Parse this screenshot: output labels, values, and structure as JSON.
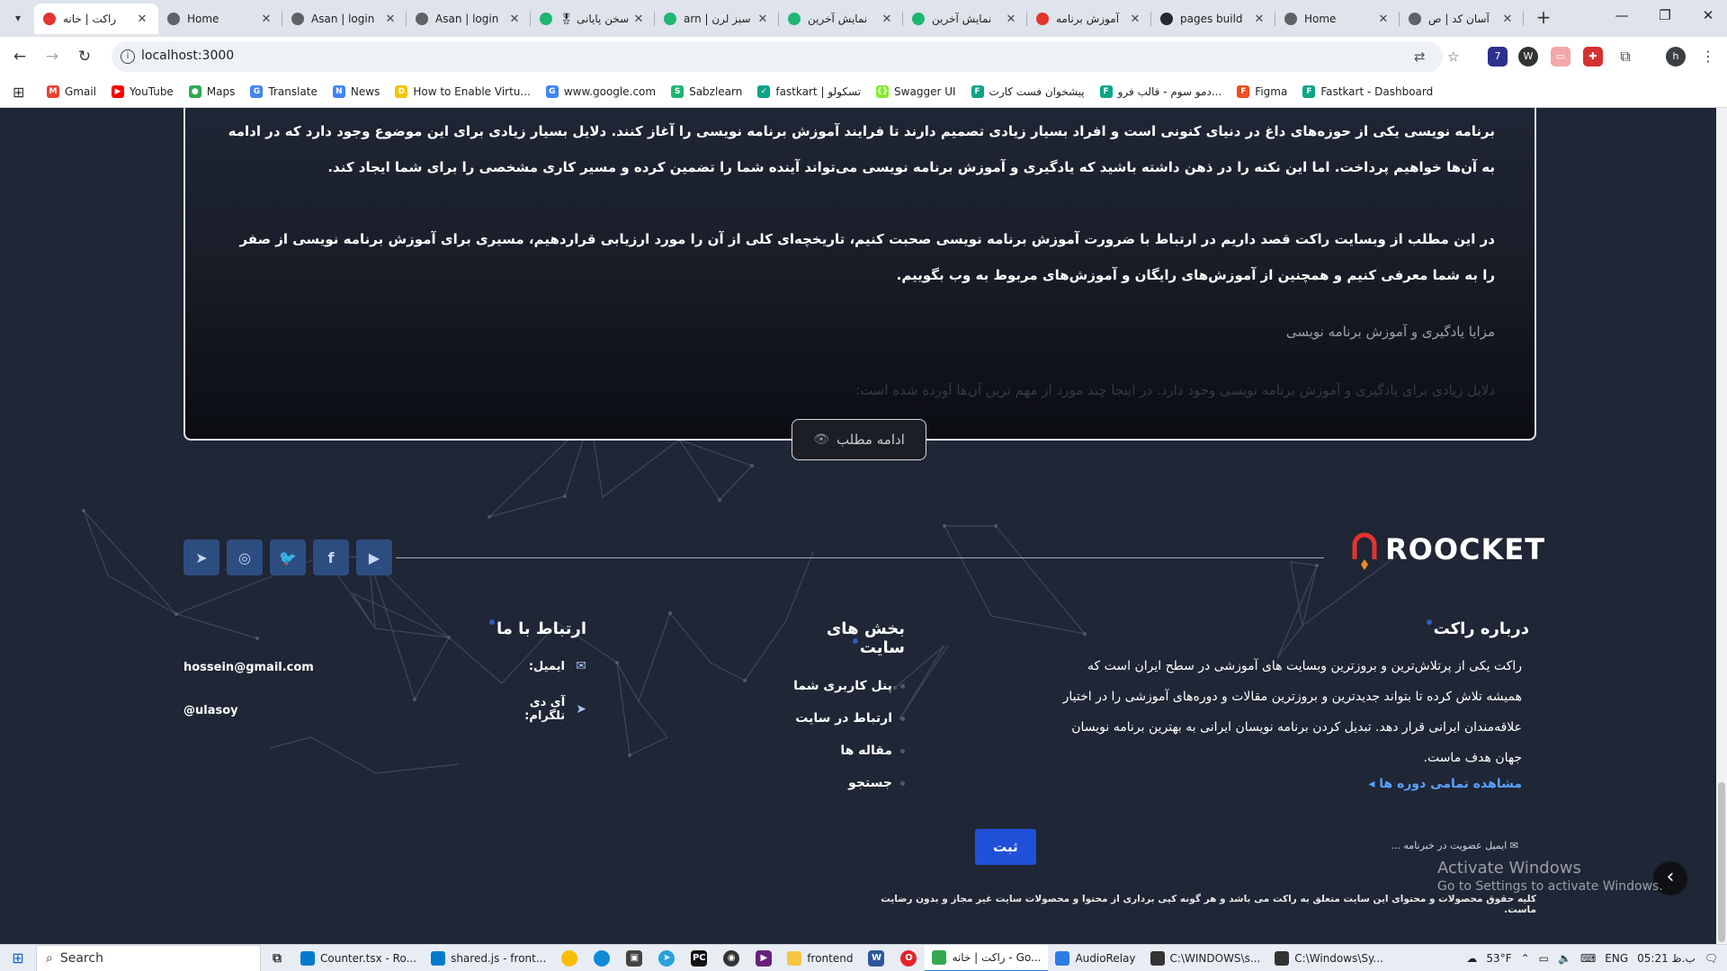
{
  "browser": {
    "tabs": [
      {
        "label": "راکت | خانه",
        "favicon": "roocket-icon",
        "color": "#e3342f",
        "active": true
      },
      {
        "label": "Home",
        "favicon": "globe-icon",
        "color": "#5f6368"
      },
      {
        "label": "Asan | login",
        "favicon": "globe-icon",
        "color": "#5f6368"
      },
      {
        "label": "Asan | login",
        "favicon": "globe-icon",
        "color": "#5f6368"
      },
      {
        "label": "سخن پایانی 🎖",
        "favicon": "sabzlearn-icon",
        "color": "#1fb573"
      },
      {
        "label": "سبز لرن | arn",
        "favicon": "sabzlearn-icon",
        "color": "#1fb573"
      },
      {
        "label": "نمایش آخرین",
        "favicon": "sabzlearn-icon",
        "color": "#1fb573"
      },
      {
        "label": "نمایش آخرین",
        "favicon": "sabzlearn-icon",
        "color": "#1fb573"
      },
      {
        "label": "آموزش برنامه",
        "favicon": "roocket-icon",
        "color": "#e3342f"
      },
      {
        "label": "pages build",
        "favicon": "github-icon",
        "color": "#24292f"
      },
      {
        "label": "Home",
        "favicon": "globe-icon",
        "color": "#5f6368"
      },
      {
        "label": "آسان کد | ص",
        "favicon": "globe-icon",
        "color": "#5f6368"
      }
    ],
    "new_tab_symbol": "+",
    "url": "localhost:3000",
    "bookmarks": [
      {
        "label": "Gmail",
        "icon": "gmail-icon",
        "color": "#ea4335",
        "glyph": "M"
      },
      {
        "label": "YouTube",
        "icon": "youtube-icon",
        "color": "#ff0000",
        "glyph": "▶"
      },
      {
        "label": "Maps",
        "icon": "maps-icon",
        "color": "#34a853",
        "glyph": "●"
      },
      {
        "label": "Translate",
        "icon": "translate-icon",
        "color": "#4285f4",
        "glyph": "G"
      },
      {
        "label": "News",
        "icon": "news-icon",
        "color": "#4285f4",
        "glyph": "N"
      },
      {
        "label": "How to Enable Virtu...",
        "icon": "bookmark-site-icon",
        "color": "#f5c400",
        "glyph": "D"
      },
      {
        "label": "www.google.com",
        "icon": "google-icon",
        "color": "#4285f4",
        "glyph": "G"
      },
      {
        "label": "Sabzlearn",
        "icon": "sabzlearn-icon",
        "color": "#1fb573",
        "glyph": "S"
      },
      {
        "label": "fastkart | تسکولو",
        "icon": "fastkart-icon",
        "color": "#0da487",
        "glyph": "✓"
      },
      {
        "label": "Swagger UI",
        "icon": "swagger-icon",
        "color": "#85ea2d",
        "glyph": "{}"
      },
      {
        "label": "پیشخوان فست کارت",
        "icon": "fastkart-icon",
        "color": "#0da487",
        "glyph": "F"
      },
      {
        "label": "دمو سوم - قالب فرو...",
        "icon": "fastkart-icon",
        "color": "#0da487",
        "glyph": "F"
      },
      {
        "label": "Figma",
        "icon": "figma-icon",
        "color": "#f24e1e",
        "glyph": "F"
      },
      {
        "label": "Fastkart - Dashboard",
        "icon": "fastkart-icon",
        "color": "#0da487",
        "glyph": "F"
      }
    ]
  },
  "article": {
    "paragraph1": "برنامه نویسی یکی از حوزه‌های داغ در دنیای کنونی است و افراد بسیار زیادی تصمیم دارند تا فرایند آموزش برنامه نویسی را آغاز کنند. دلایل بسیار زیادی برای این موضوع وجود دارد که در ادامه به آن‌ها خواهیم پرداخت. اما این نکته را در ذهن داشته باشید که یادگیری و آموزش برنامه نویسی می‌تواند آینده شما را تضمین کرده و مسیر کاری مشخصی را برای شما ایجاد کند.",
    "paragraph2": "در این مطلب از وبسایت راکت قصد داریم در ارتباط با ضرورت آموزش برنامه نویسی صحبت کنیم، تاریخچه‌ای کلی از آن را مورد ارزیابی قراردهیم، مسیری برای آموزش برنامه نویسی از صفر را به شما معرفی کنیم و همچنین از آموزش‌های رایگان و آموزش‌های مربوط به وب بگوییم.",
    "heading": "مزایا یادگیری و آموزش برنامه نویسی",
    "paragraph3": "دلایل زیادی برای یادگیری و آموزش برنامه نویسی وجود دارد. در اینجا چند مورد از مهم ترین آن‌ها آورده شده است:",
    "read_more": "ادامه مطلب"
  },
  "footer": {
    "logo_text": "ROOCKET",
    "socials": [
      {
        "name": "telegram-icon",
        "glyph": "➤"
      },
      {
        "name": "instagram-icon",
        "glyph": "◎"
      },
      {
        "name": "twitter-icon",
        "glyph": "🐦"
      },
      {
        "name": "facebook-icon",
        "glyph": "f"
      },
      {
        "name": "youtube-icon",
        "glyph": "▶"
      }
    ],
    "about": {
      "title": "درباره راکت",
      "text": "راکت یکی از پرتلاش‌ترین و بروزترین وبسایت های آموزشی در سطح ایران است که همیشه تلاش کرده تا بتواند جدیدترین و بروزترین مقالات و دوره‌های آموزشی را در اختیار علاقه‌مندان ایرانی قرار دهد. تبدیل کردن برنامه نویسان ایرانی به بهترین برنامه نویسان جهان هدف ماست.",
      "link": "مشاهده تمامی دوره ها ◂"
    },
    "sections": {
      "title": "بخش های سایت",
      "items": [
        "پنل کاربری شما",
        "ارتباط در سایت",
        "مقاله ها",
        "جستجو"
      ]
    },
    "contact": {
      "title": "ارتباط با ما",
      "email_label": "ایمیل:",
      "email_value": "hossein@gmail.com",
      "telegram_label": "آی دی تلگرام:",
      "telegram_value": "@ulasoy"
    },
    "newsletter": {
      "button": "ثبت",
      "placeholder": "ایمیل عضویت در خبرنامه ..."
    },
    "copyright": "کلیه حقوق محصولات و محتوای این سایت متعلق به راکت می باشد و هر گونه کپی برداری از محتوا و محصولات سایت غیر مجاز و بدون رضایت ماست.",
    "brand_color": "#2150d8",
    "accent_color": "#e3342f"
  },
  "watermark": {
    "line1": "Activate Windows",
    "line2": "Go to Settings to activate Windows."
  },
  "taskbar": {
    "search_placeholder": "Search",
    "apps": [
      {
        "label": "Counter.tsx - Ro...",
        "icon": "vscode-icon",
        "color": "#007acc"
      },
      {
        "label": "shared.js - front...",
        "icon": "vscode-icon",
        "color": "#007acc"
      }
    ],
    "apps2": [
      {
        "label": "frontend",
        "icon": "folder-icon",
        "color": "#f4c542"
      }
    ],
    "apps3": [
      {
        "label": "راکت | خانه - Go...",
        "icon": "chrome-icon",
        "color": "#34a853",
        "active": true
      },
      {
        "label": "AudioRelay",
        "icon": "audiorelay-icon",
        "color": "#2d7be5"
      },
      {
        "label": "C:\\WINDOWS\\s...",
        "icon": "terminal-icon",
        "color": "#333333"
      },
      {
        "label": "C:\\Windows\\Sy...",
        "icon": "terminal-icon",
        "color": "#333333"
      }
    ],
    "weather": "53°F",
    "language": "ENG",
    "time": "05:21 ب.ظ"
  }
}
